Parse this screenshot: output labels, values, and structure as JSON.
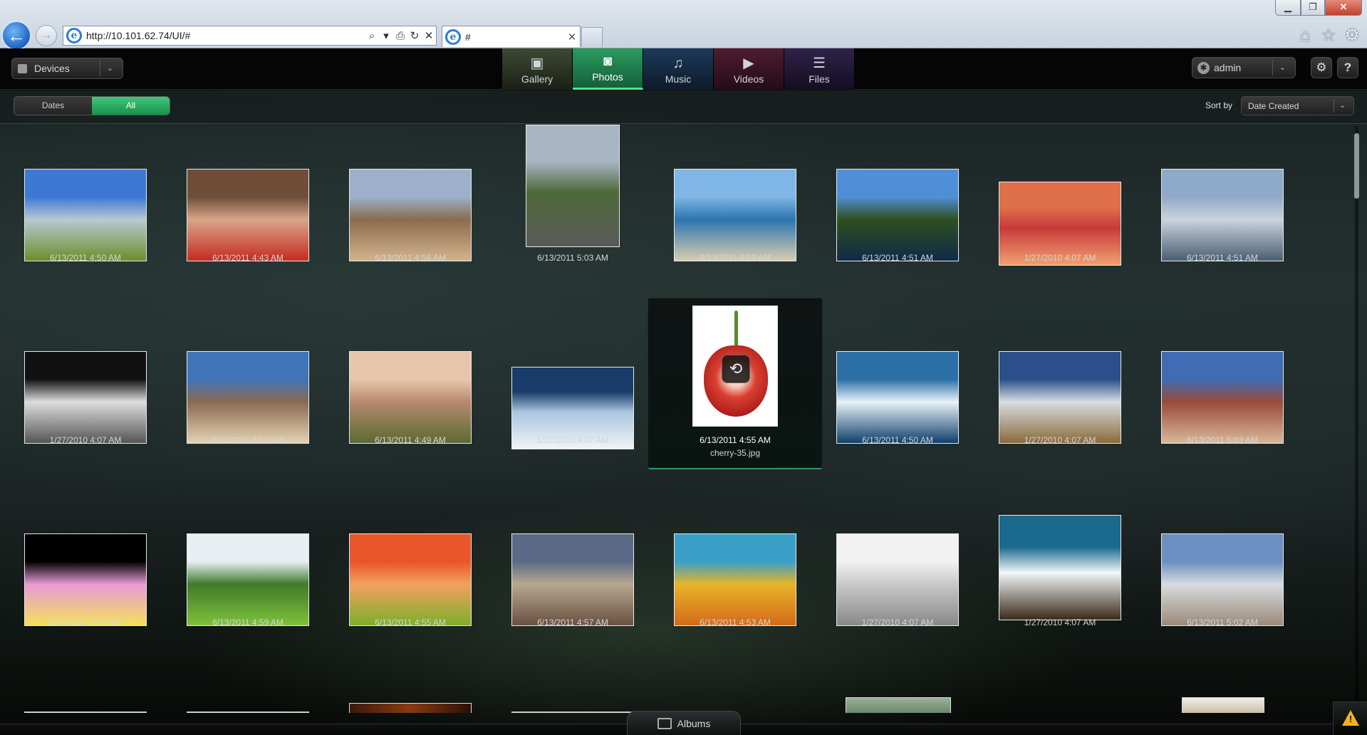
{
  "browser": {
    "address": "http://10.101.62.74/UI/#",
    "tab_title": "#",
    "win_min": "▁",
    "win_max": "❐",
    "win_close": "✕",
    "address_tools": [
      "⌕",
      "▾",
      "⎙",
      "↻",
      "✕"
    ],
    "tab_close": "✕",
    "back_glyph": "←",
    "forward_glyph": "→",
    "home_glyph": "⌂",
    "star_glyph": "☆",
    "tools_glyph": "⚙"
  },
  "header": {
    "devices_label": "Devices",
    "tabs": [
      {
        "label": "Gallery",
        "icon": "gallery-icon",
        "glyph": "▣"
      },
      {
        "label": "Photos",
        "icon": "camera-icon",
        "glyph": "◙"
      },
      {
        "label": "Music",
        "icon": "music-note-icon",
        "glyph": "♫"
      },
      {
        "label": "Videos",
        "icon": "video-camera-icon",
        "glyph": "▶"
      },
      {
        "label": "Files",
        "icon": "document-icon",
        "glyph": "☰"
      }
    ],
    "user_label": "admin",
    "user_glyph": "✱",
    "settings_glyph": "⚙",
    "help_glyph": "?",
    "active_tab": "Photos"
  },
  "filter": {
    "dates_label": "Dates",
    "all_label": "All",
    "active": "All",
    "sort_label": "Sort by",
    "sort_value": "Date Created",
    "arrow": "⌄"
  },
  "photos": [
    {
      "date": "6/13/2011 4:50 AM",
      "subject": "mountain valley",
      "c1": "#3d78d4",
      "c2": "#b8c9d1",
      "c3": "#6b8f2a"
    },
    {
      "date": "6/13/2011 4:43 AM",
      "subject": "portrait",
      "c1": "#6e4e38",
      "c2": "#d9a58a",
      "c3": "#c42b1e"
    },
    {
      "date": "6/13/2011 4:56 AM",
      "subject": "canyon",
      "c1": "#9cb0cc",
      "c2": "#8a6c4e",
      "c3": "#d2b48c"
    },
    {
      "date": "6/13/2011 5:03 AM",
      "subject": "capitol street",
      "c1": "#a8b5c2",
      "c2": "#4f6a3a",
      "c3": "#5a5a5a"
    },
    {
      "date": "6/13/2011 4:59 AM",
      "subject": "beach",
      "c1": "#7fb6e6",
      "c2": "#2c75b0",
      "c3": "#d8ccb0"
    },
    {
      "date": "6/13/2011 4:51 AM",
      "subject": "alpine lake",
      "c1": "#4f8fd8",
      "c2": "#2e4f1e",
      "c3": "#102a4a"
    },
    {
      "date": "1/27/2010 4:07 AM",
      "subject": "sandstone waves",
      "c1": "#e0704a",
      "c2": "#c73a3a",
      "c3": "#f0a070"
    },
    {
      "date": "6/13/2011 4:51 AM",
      "subject": "skyscrapers",
      "c1": "#8fa9c8",
      "c2": "#c9d3dc",
      "c3": "#4a5f74"
    },
    {
      "date": "1/27/2010 4:07 AM",
      "subject": "abstract waves",
      "c1": "#111111",
      "c2": "#dddddd",
      "c3": "#555555"
    },
    {
      "date": "6/13/2011 4:51 AM",
      "subject": "sand dunes",
      "c1": "#3f74b8",
      "c2": "#8a6a52",
      "c3": "#e4d2b4"
    },
    {
      "date": "6/13/2011 4:49 AM",
      "subject": "eye",
      "c1": "#e8c6ad",
      "c2": "#b78a6f",
      "c3": "#5b6a32"
    },
    {
      "date": "1/27/2010 4:07 AM",
      "subject": "ice texture",
      "c1": "#1a3c6a",
      "c2": "#aac6e0",
      "c3": "#f0f4f8"
    },
    {
      "date": "6/13/2011 4:55 AM",
      "subject": "cherry",
      "filename": "cherry-35.jpg",
      "selected": true,
      "c1": "#ffffff",
      "c2": "#c92626",
      "c3": "#4a8a2a"
    },
    {
      "date": "6/13/2011 4:50 AM",
      "subject": "surfer",
      "c1": "#2a6fa6",
      "c2": "#e8f2f8",
      "c3": "#0f3f6a"
    },
    {
      "date": "1/27/2010 4:07 AM",
      "subject": "reflections",
      "c1": "#2a4f8a",
      "c2": "#d8dde2",
      "c3": "#8a6a3a"
    },
    {
      "date": "6/13/2011 5:03 AM",
      "subject": "painted hills",
      "c1": "#3f6cb4",
      "c2": "#9a4a3a",
      "c3": "#d8b89a"
    },
    {
      "date": "6/13/2011 4:54 AM",
      "subject": "pink flower",
      "c1": "#000000",
      "c2": "#e79ad6",
      "c3": "#f4e05a"
    },
    {
      "date": "6/13/2011 4:59 AM",
      "subject": "garden maze",
      "c1": "#e8eef2",
      "c2": "#3f7a2a",
      "c3": "#7ec23a"
    },
    {
      "date": "6/13/2011 4:55 AM",
      "subject": "orange flower",
      "c1": "#e8562a",
      "c2": "#f4a060",
      "c3": "#7ab02a"
    },
    {
      "date": "6/13/2011 4:57 AM",
      "subject": "canyon overlook",
      "c1": "#5a6a86",
      "c2": "#b8a890",
      "c3": "#6a5040"
    },
    {
      "date": "6/13/2011 4:53 AM",
      "subject": "hot spring",
      "c1": "#3aa0c8",
      "c2": "#e8b42a",
      "c3": "#d46a1a"
    },
    {
      "date": "1/27/2010 4:07 AM",
      "subject": "white architecture",
      "c1": "#f2f2f2",
      "c2": "#c8c8c8",
      "c3": "#888888"
    },
    {
      "date": "1/27/2010 4:07 AM",
      "subject": "dandelion",
      "c1": "#1a6a8e",
      "c2": "#f2f6f8",
      "c3": "#3a2a1a"
    },
    {
      "date": "6/13/2011 5:02 AM",
      "subject": "salt flats",
      "c1": "#6a8fc0",
      "c2": "#d8dce0",
      "c3": "#9a8a78"
    }
  ],
  "albums_label": "Albums"
}
